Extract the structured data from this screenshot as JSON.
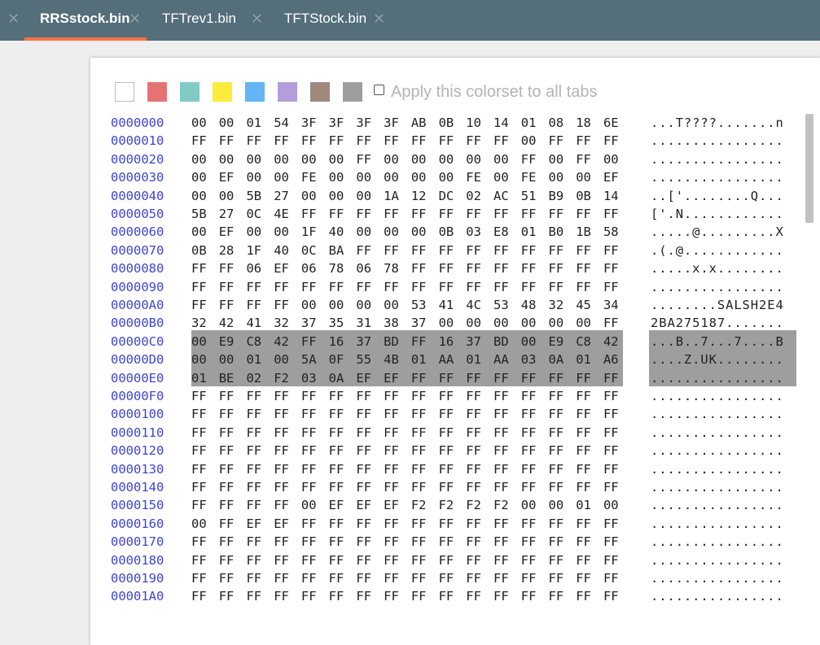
{
  "tabs": [
    {
      "label": "RRSstock.bin",
      "active": true
    },
    {
      "label": "TFTrev1.bin",
      "active": false
    },
    {
      "label": "TFTStock.bin",
      "active": false
    }
  ],
  "colors": {
    "tabbar": "#546e7a",
    "active_underline": "#ff7043",
    "address": "#3f45d6",
    "highlight": "#9e9e9e"
  },
  "colorset": {
    "swatches": [
      {
        "name": "white",
        "color": "#ffffff"
      },
      {
        "name": "red",
        "color": "#e57373"
      },
      {
        "name": "teal",
        "color": "#80cbc4"
      },
      {
        "name": "yellow",
        "color": "#ffeb3b"
      },
      {
        "name": "blue",
        "color": "#64b5f6"
      },
      {
        "name": "purple",
        "color": "#b39ddb"
      },
      {
        "name": "brown",
        "color": "#a1887f"
      },
      {
        "name": "gray",
        "color": "#9e9e9e"
      }
    ],
    "apply_label": "Apply this colorset to all tabs",
    "apply_checked": false
  },
  "hex_rows": [
    {
      "addr": "0000000",
      "bytes": [
        "00",
        "00",
        "01",
        "54",
        "3F",
        "3F",
        "3F",
        "3F",
        "AB",
        "0B",
        "10",
        "14",
        "01",
        "08",
        "18",
        "6E"
      ],
      "ascii": "...T????.......n"
    },
    {
      "addr": "0000010",
      "bytes": [
        "FF",
        "FF",
        "FF",
        "FF",
        "FF",
        "FF",
        "FF",
        "FF",
        "FF",
        "FF",
        "FF",
        "FF",
        "00",
        "FF",
        "FF",
        "FF"
      ],
      "ascii": "................"
    },
    {
      "addr": "0000020",
      "bytes": [
        "00",
        "00",
        "00",
        "00",
        "00",
        "00",
        "FF",
        "00",
        "00",
        "00",
        "00",
        "00",
        "FF",
        "00",
        "FF",
        "00"
      ],
      "ascii": "................"
    },
    {
      "addr": "0000030",
      "bytes": [
        "00",
        "EF",
        "00",
        "00",
        "FE",
        "00",
        "00",
        "00",
        "00",
        "00",
        "FE",
        "00",
        "FE",
        "00",
        "00",
        "EF"
      ],
      "ascii": "................"
    },
    {
      "addr": "0000040",
      "bytes": [
        "00",
        "00",
        "5B",
        "27",
        "00",
        "00",
        "00",
        "1A",
        "12",
        "DC",
        "02",
        "AC",
        "51",
        "B9",
        "0B",
        "14"
      ],
      "ascii": "..['........Q..."
    },
    {
      "addr": "0000050",
      "bytes": [
        "5B",
        "27",
        "0C",
        "4E",
        "FF",
        "FF",
        "FF",
        "FF",
        "FF",
        "FF",
        "FF",
        "FF",
        "FF",
        "FF",
        "FF",
        "FF"
      ],
      "ascii": "['.N............"
    },
    {
      "addr": "0000060",
      "bytes": [
        "00",
        "EF",
        "00",
        "00",
        "1F",
        "40",
        "00",
        "00",
        "00",
        "0B",
        "03",
        "E8",
        "01",
        "B0",
        "1B",
        "58"
      ],
      "ascii": ".....@.........X"
    },
    {
      "addr": "0000070",
      "bytes": [
        "0B",
        "28",
        "1F",
        "40",
        "0C",
        "BA",
        "FF",
        "FF",
        "FF",
        "FF",
        "FF",
        "FF",
        "FF",
        "FF",
        "FF",
        "FF"
      ],
      "ascii": ".(.@............"
    },
    {
      "addr": "0000080",
      "bytes": [
        "FF",
        "FF",
        "06",
        "EF",
        "06",
        "78",
        "06",
        "78",
        "FF",
        "FF",
        "FF",
        "FF",
        "FF",
        "FF",
        "FF",
        "FF"
      ],
      "ascii": ".....x.x........"
    },
    {
      "addr": "0000090",
      "bytes": [
        "FF",
        "FF",
        "FF",
        "FF",
        "FF",
        "FF",
        "FF",
        "FF",
        "FF",
        "FF",
        "FF",
        "FF",
        "FF",
        "FF",
        "FF",
        "FF"
      ],
      "ascii": "................"
    },
    {
      "addr": "00000A0",
      "bytes": [
        "FF",
        "FF",
        "FF",
        "FF",
        "00",
        "00",
        "00",
        "00",
        "53",
        "41",
        "4C",
        "53",
        "48",
        "32",
        "45",
        "34"
      ],
      "ascii": "........SALSH2E4"
    },
    {
      "addr": "00000B0",
      "bytes": [
        "32",
        "42",
        "41",
        "32",
        "37",
        "35",
        "31",
        "38",
        "37",
        "00",
        "00",
        "00",
        "00",
        "00",
        "00",
        "FF"
      ],
      "ascii": "2BA275187......."
    },
    {
      "addr": "00000C0",
      "bytes": [
        "00",
        "E9",
        "C8",
        "42",
        "FF",
        "16",
        "37",
        "BD",
        "FF",
        "16",
        "37",
        "BD",
        "00",
        "E9",
        "C8",
        "42"
      ],
      "ascii": "...B..7...7....B",
      "highlight": true
    },
    {
      "addr": "00000D0",
      "bytes": [
        "00",
        "00",
        "01",
        "00",
        "5A",
        "0F",
        "55",
        "4B",
        "01",
        "AA",
        "01",
        "AA",
        "03",
        "0A",
        "01",
        "A6"
      ],
      "ascii": "....Z.UK........",
      "highlight": true
    },
    {
      "addr": "00000E0",
      "bytes": [
        "01",
        "BE",
        "02",
        "F2",
        "03",
        "0A",
        "EF",
        "EF",
        "FF",
        "FF",
        "FF",
        "FF",
        "FF",
        "FF",
        "FF",
        "FF"
      ],
      "ascii": "................",
      "highlight": true
    },
    {
      "addr": "00000F0",
      "bytes": [
        "FF",
        "FF",
        "FF",
        "FF",
        "FF",
        "FF",
        "FF",
        "FF",
        "FF",
        "FF",
        "FF",
        "FF",
        "FF",
        "FF",
        "FF",
        "FF"
      ],
      "ascii": "................"
    },
    {
      "addr": "0000100",
      "bytes": [
        "FF",
        "FF",
        "FF",
        "FF",
        "FF",
        "FF",
        "FF",
        "FF",
        "FF",
        "FF",
        "FF",
        "FF",
        "FF",
        "FF",
        "FF",
        "FF"
      ],
      "ascii": "................"
    },
    {
      "addr": "0000110",
      "bytes": [
        "FF",
        "FF",
        "FF",
        "FF",
        "FF",
        "FF",
        "FF",
        "FF",
        "FF",
        "FF",
        "FF",
        "FF",
        "FF",
        "FF",
        "FF",
        "FF"
      ],
      "ascii": "................"
    },
    {
      "addr": "0000120",
      "bytes": [
        "FF",
        "FF",
        "FF",
        "FF",
        "FF",
        "FF",
        "FF",
        "FF",
        "FF",
        "FF",
        "FF",
        "FF",
        "FF",
        "FF",
        "FF",
        "FF"
      ],
      "ascii": "................"
    },
    {
      "addr": "0000130",
      "bytes": [
        "FF",
        "FF",
        "FF",
        "FF",
        "FF",
        "FF",
        "FF",
        "FF",
        "FF",
        "FF",
        "FF",
        "FF",
        "FF",
        "FF",
        "FF",
        "FF"
      ],
      "ascii": "................"
    },
    {
      "addr": "0000140",
      "bytes": [
        "FF",
        "FF",
        "FF",
        "FF",
        "FF",
        "FF",
        "FF",
        "FF",
        "FF",
        "FF",
        "FF",
        "FF",
        "FF",
        "FF",
        "FF",
        "FF"
      ],
      "ascii": "................"
    },
    {
      "addr": "0000150",
      "bytes": [
        "FF",
        "FF",
        "FF",
        "FF",
        "00",
        "EF",
        "EF",
        "EF",
        "F2",
        "F2",
        "F2",
        "F2",
        "00",
        "00",
        "01",
        "00"
      ],
      "ascii": "................"
    },
    {
      "addr": "0000160",
      "bytes": [
        "00",
        "FF",
        "EF",
        "EF",
        "FF",
        "FF",
        "FF",
        "FF",
        "FF",
        "FF",
        "FF",
        "FF",
        "FF",
        "FF",
        "FF",
        "FF"
      ],
      "ascii": "................"
    },
    {
      "addr": "0000170",
      "bytes": [
        "FF",
        "FF",
        "FF",
        "FF",
        "FF",
        "FF",
        "FF",
        "FF",
        "FF",
        "FF",
        "FF",
        "FF",
        "FF",
        "FF",
        "FF",
        "FF"
      ],
      "ascii": "................"
    },
    {
      "addr": "0000180",
      "bytes": [
        "FF",
        "FF",
        "FF",
        "FF",
        "FF",
        "FF",
        "FF",
        "FF",
        "FF",
        "FF",
        "FF",
        "FF",
        "FF",
        "FF",
        "FF",
        "FF"
      ],
      "ascii": "................"
    },
    {
      "addr": "0000190",
      "bytes": [
        "FF",
        "FF",
        "FF",
        "FF",
        "FF",
        "FF",
        "FF",
        "FF",
        "FF",
        "FF",
        "FF",
        "FF",
        "FF",
        "FF",
        "FF",
        "FF"
      ],
      "ascii": "................"
    },
    {
      "addr": "00001A0",
      "bytes": [
        "FF",
        "FF",
        "FF",
        "FF",
        "FF",
        "FF",
        "FF",
        "FF",
        "FF",
        "FF",
        "FF",
        "FF",
        "FF",
        "FF",
        "FF",
        "FF"
      ],
      "ascii": "................"
    }
  ]
}
